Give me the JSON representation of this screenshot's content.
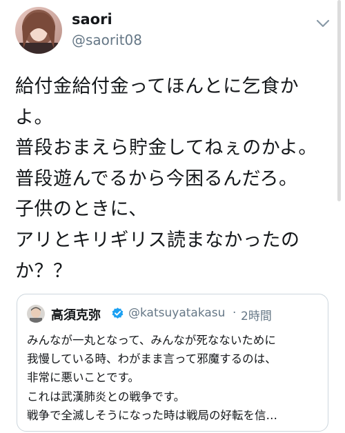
{
  "tweet": {
    "author": {
      "name": "saori",
      "handle": "@saorit08"
    },
    "lines": [
      "給付金給付金ってほんとに乞食か",
      "よ。",
      "普段おまえら貯金してねぇのかよ。",
      "普段遊んでるから今困るんだろ。",
      "子供のときに、",
      "アリとキリギリス読まなかったの",
      "か？？"
    ]
  },
  "quoted_tweet": {
    "author": {
      "name": "高須克弥",
      "handle": "@katsuyatakasu",
      "separator": "·",
      "time": "2時間"
    },
    "lines": [
      "みんなが一丸となって、みんなが死なないために",
      "我慢している時、わがまま言って邪魔するのは、",
      "非常に悪いことです。",
      "これは武漢肺炎との戦争です。",
      "戦争で全滅しそうになった時は戦局の好転を信…"
    ]
  },
  "colors": {
    "text": "#14171a",
    "secondary": "#657786",
    "verified": "#1da1f2",
    "border": "#ccd6dd"
  },
  "icons": {
    "caret": "chevron-down-icon",
    "verified": "verified-badge-icon"
  }
}
